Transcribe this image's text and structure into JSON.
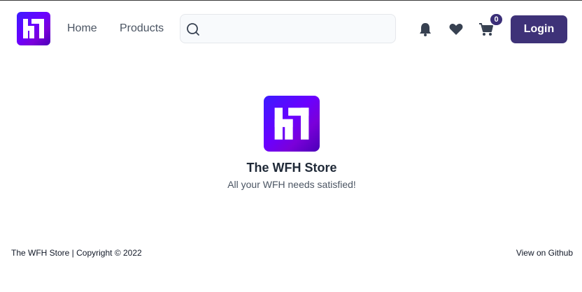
{
  "header": {
    "nav": {
      "home_label": "Home",
      "products_label": "Products"
    },
    "search": {
      "value": "",
      "icon": "search-icon"
    },
    "icons": {
      "notifications": "bell-icon",
      "wishlist": "heart-icon",
      "cart": "cart-icon"
    },
    "cart_count": "0",
    "login_label": "Login"
  },
  "hero": {
    "title": "The WFH Store",
    "subtitle": "All your WFH needs satisfied!"
  },
  "footer": {
    "copyright": "The WFH Store | Copyright © 2022",
    "github_link": "View on Github"
  },
  "colors": {
    "primary": "#3e3278",
    "logo_gradient_start": "#3b1cff",
    "logo_gradient_end": "#7a00d9",
    "icon": "#374151"
  }
}
